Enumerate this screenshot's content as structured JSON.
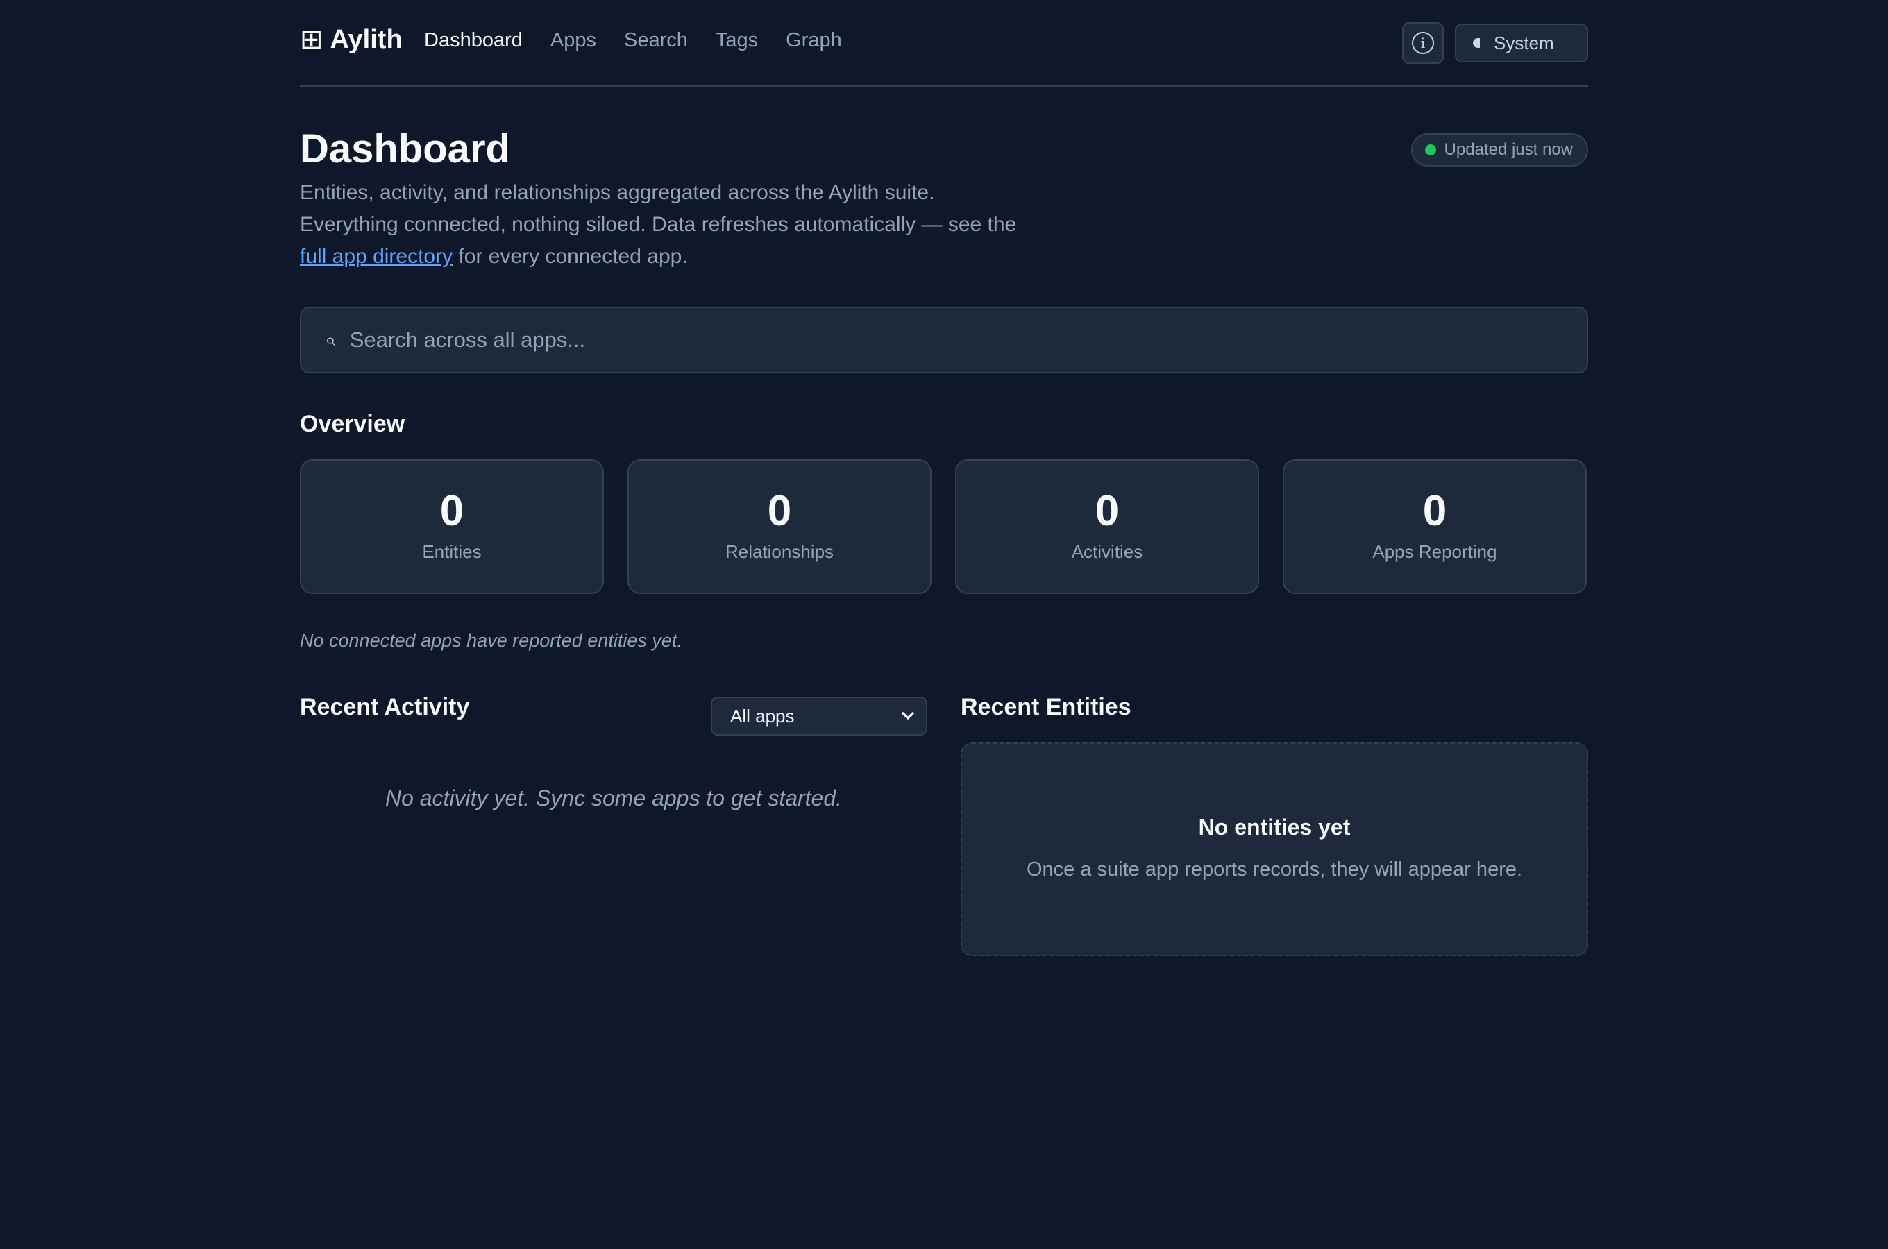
{
  "nav": {
    "brand_icon": "⊞",
    "brand_name": "Aylith",
    "links": [
      "Dashboard",
      "Apps",
      "Search",
      "Tags",
      "Graph"
    ],
    "active": "Dashboard",
    "info_icon": "i",
    "theme_label": "System"
  },
  "header": {
    "title": "Dashboard",
    "badge": "Updated just now",
    "intro_before": "Entities, activity, and relationships aggregated across the Aylith suite. Everything connected, nothing siloed. Data refreshes automatically — see the ",
    "intro_link": "full app directory",
    "intro_after": " for every connected app."
  },
  "search": {
    "icon": "⌕",
    "placeholder": "Search across all apps..."
  },
  "overview": {
    "title": "Overview",
    "stats": [
      {
        "value": "0",
        "label": "Entities"
      },
      {
        "value": "0",
        "label": "Relationships"
      },
      {
        "value": "0",
        "label": "Activities"
      },
      {
        "value": "0",
        "label": "Apps Reporting"
      }
    ],
    "note": "No connected apps have reported entities yet."
  },
  "recent_activity": {
    "title": "Recent Activity",
    "filter_value": "All apps",
    "empty": "No activity yet. Sync some apps to get started."
  },
  "recent_entities": {
    "title": "Recent Entities",
    "empty_title": "No entities yet",
    "empty_text": "Once a suite app reports records, they will appear here."
  },
  "colors": {
    "background": "#0f172a",
    "surface": "#1e293b",
    "border": "#334155",
    "muted_text": "#94a3b8",
    "link": "#60a5fa",
    "status_ok": "#22c55e"
  }
}
